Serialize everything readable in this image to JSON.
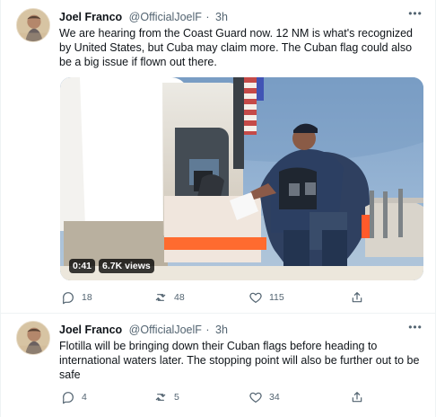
{
  "tweets": [
    {
      "author": {
        "display_name": "Joel Franco",
        "handle": "@OfficialJoelF",
        "separator": "·",
        "time": "3h"
      },
      "text": "We are hearing from the Coast Guard now. 12 NM is what's recognized by United States, but Cuba may claim more. The Cuban flag could also be a big issue if flown out there.",
      "media": {
        "duration": "0:41",
        "views": "6.7K views"
      },
      "actions": {
        "replies": "18",
        "retweets": "48",
        "likes": "115"
      },
      "icons": {
        "more": "more-icon",
        "reply": "reply-icon",
        "retweet": "retweet-icon",
        "like": "like-icon",
        "share": "share-icon"
      }
    },
    {
      "author": {
        "display_name": "Joel Franco",
        "handle": "@OfficialJoelF",
        "separator": "·",
        "time": "3h"
      },
      "text": "Flotilla will be bringing down their Cuban flags before heading to international waters later. The stopping point will also be further out to be safe",
      "actions": {
        "replies": "4",
        "retweets": "5",
        "likes": "34"
      },
      "icons": {
        "more": "more-icon",
        "reply": "reply-icon",
        "retweet": "retweet-icon",
        "like": "like-icon",
        "share": "share-icon"
      }
    }
  ],
  "colors": {
    "text_primary": "#0f1419",
    "text_secondary": "#536471",
    "border": "#eff3f4",
    "video_badge": "#000000"
  }
}
